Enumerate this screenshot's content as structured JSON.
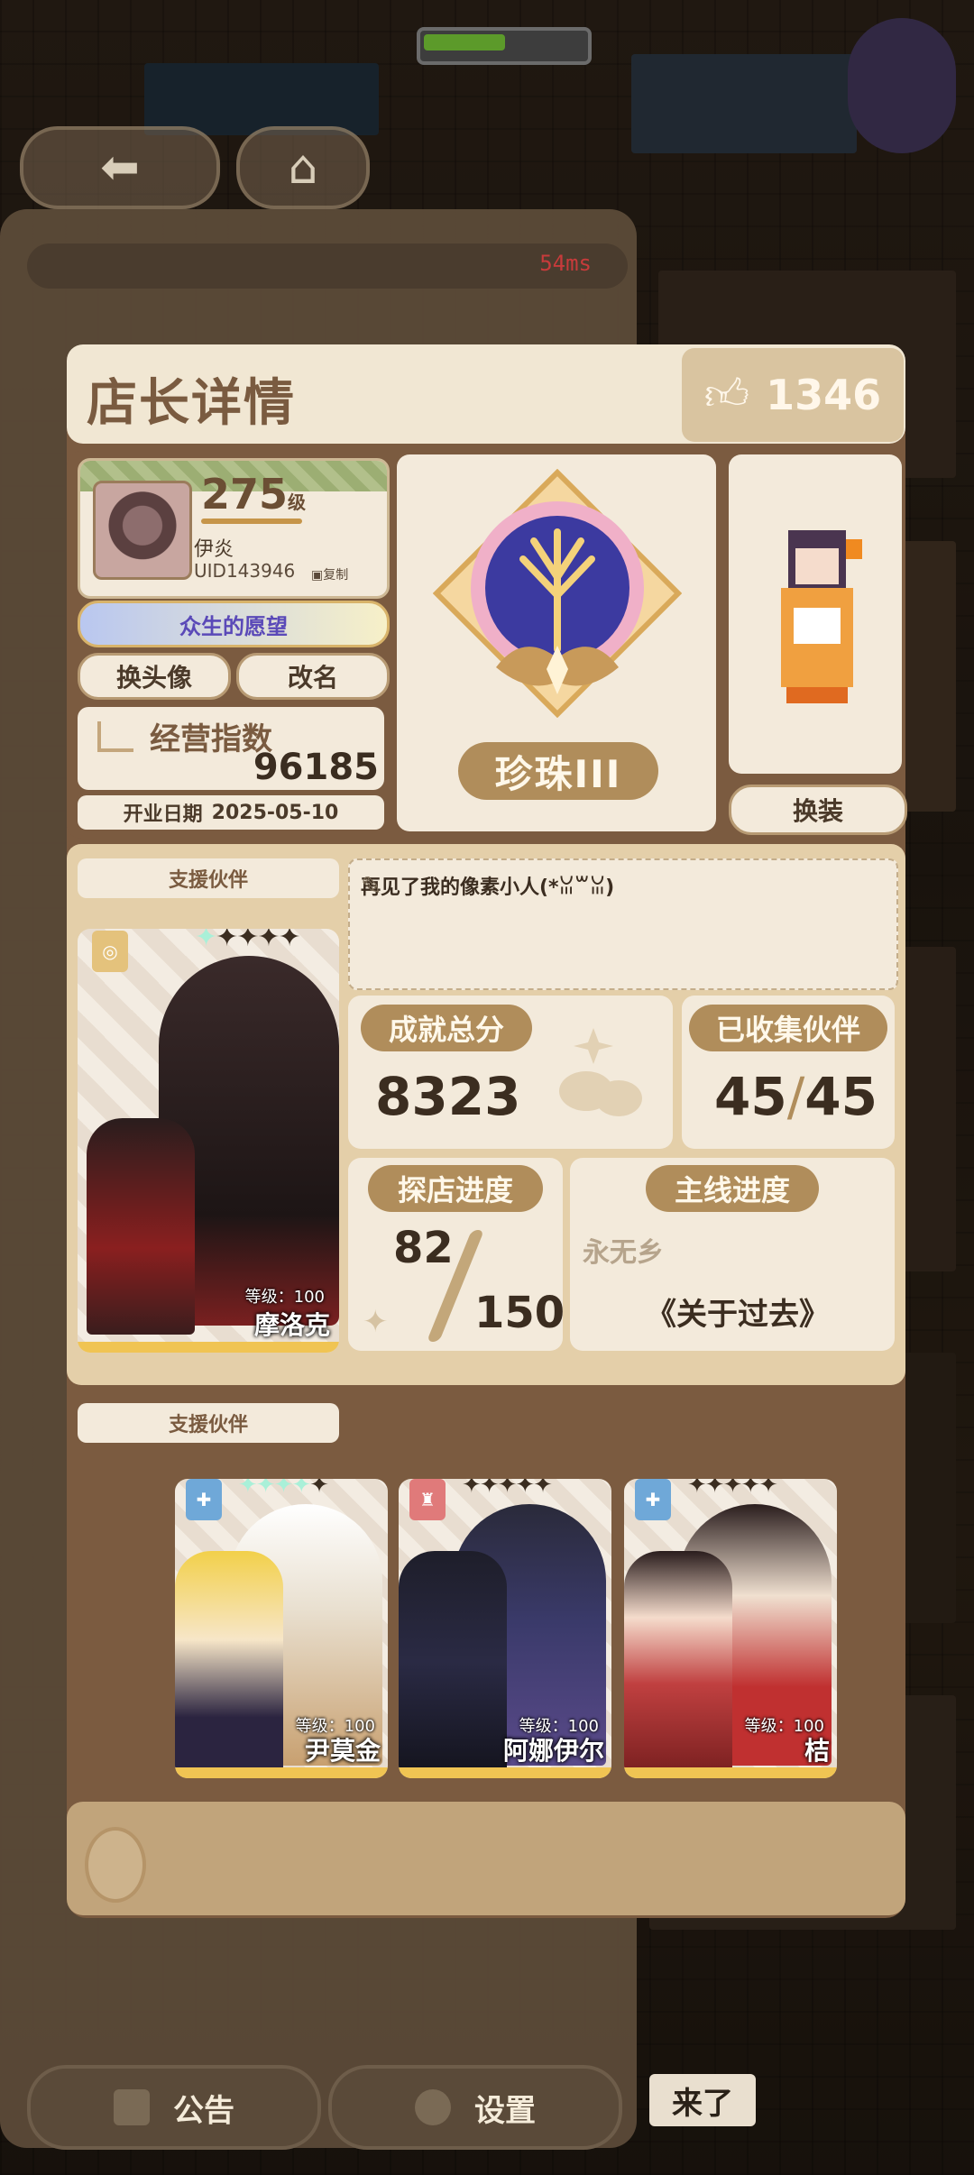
{
  "game_hud": {
    "ping": "54ms",
    "back_icon": "arrow-left-icon",
    "home_icon": "home-icon"
  },
  "bottom_bar": {
    "notice_label": "公告",
    "settings_label": "设置",
    "chat_chip": "来了"
  },
  "dialog": {
    "title": "店长详情",
    "likes": "1346",
    "profile": {
      "level": "275",
      "level_suffix": "级",
      "name": "伊炎",
      "uid": "UID143946",
      "copy_label": "复制",
      "title_badge": "众生的愿望"
    },
    "buttons": {
      "change_avatar": "换头像",
      "rename": "改名",
      "change_outfit": "换装"
    },
    "business": {
      "label": "经营指数",
      "value": "96185",
      "open_date_label": "开业日期",
      "open_date": "2025-05-10"
    },
    "rank": {
      "name": "珍珠III"
    },
    "support_label": "支援伙伴",
    "motto": "再见了我的像素小人(*ꈍ꒳ꈍ)",
    "stats": {
      "achievement_label": "成就总分",
      "achievement_value": "8323",
      "collected_label": "已收集伙伴",
      "collected_owned": "45",
      "collected_total": "45",
      "explore_label": "探店进度",
      "explore_current": "82",
      "explore_total": "150",
      "main_label": "主线进度",
      "main_region": "永无乡",
      "main_chapter": "《关于过去》"
    },
    "main_partner": {
      "level_label": "等级：100",
      "name": "摩洛克",
      "stars_filled": 1,
      "stars_total": 5
    },
    "partners": [
      {
        "level_label": "等级：100",
        "name": "尹莫金",
        "stars_filled": 4,
        "stars_total": 5,
        "role_icon": "blue-badge-icon"
      },
      {
        "level_label": "等级：100",
        "name": "阿娜伊尔",
        "stars_filled": 0,
        "stars_total": 5,
        "role_icon": "red-badge-icon"
      },
      {
        "level_label": "等级：100",
        "name": "桔",
        "stars_filled": 0,
        "stars_total": 5,
        "role_icon": "blue-badge-icon"
      }
    ]
  }
}
